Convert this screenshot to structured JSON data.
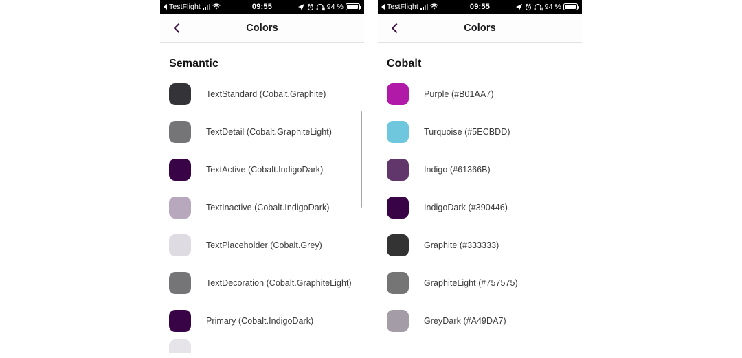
{
  "status_bar": {
    "carrier_label": "TestFlight",
    "time": "09:55",
    "battery_text": "94 %",
    "icons": {
      "back_arrow": "back-triangle-icon",
      "signal": "signal-bars-icon",
      "wifi": "wifi-icon",
      "location": "location-arrow-icon",
      "alarm": "alarm-clock-icon",
      "headphones": "headphones-icon",
      "battery": "battery-icon"
    }
  },
  "left_screen": {
    "nav": {
      "title": "Colors",
      "back_icon": "chevron-left-icon"
    },
    "section_title": "Semantic",
    "rows": [
      {
        "label": "TextStandard (Cobalt.Graphite)",
        "color": "#333338"
      },
      {
        "label": "TextDetail (Cobalt.GraphiteLight)",
        "color": "#757578"
      },
      {
        "label": "TextActive (Cobalt.IndigoDark)",
        "color": "#390446"
      },
      {
        "label": "TextInactive (Cobalt.IndigoDark)",
        "color": "#b7a8be"
      },
      {
        "label": "TextPlaceholder (Cobalt.Grey)",
        "color": "#dedce2"
      },
      {
        "label": "TextDecoration (Cobalt.GraphiteLight)",
        "color": "#757578"
      },
      {
        "label": "Primary (Cobalt.IndigoDark)",
        "color": "#390446"
      },
      {
        "label": "",
        "color": "#e6e4e8"
      }
    ]
  },
  "right_screen": {
    "nav": {
      "title": "Colors",
      "back_icon": "chevron-left-icon"
    },
    "section_title": "Cobalt",
    "rows": [
      {
        "label": "Purple (#B01AA7)",
        "color": "#b01aa7"
      },
      {
        "label": "Turquoise (#5ECBDD)",
        "color": "#6ec7dd"
      },
      {
        "label": "Indigo (#61366B)",
        "color": "#61366b"
      },
      {
        "label": "IndigoDark (#390446)",
        "color": "#390446"
      },
      {
        "label": "Graphite (#333333)",
        "color": "#333333"
      },
      {
        "label": "GraphiteLight (#757575)",
        "color": "#757575"
      },
      {
        "label": "GreyDark (#A49DA7)",
        "color": "#a49da7"
      }
    ]
  }
}
